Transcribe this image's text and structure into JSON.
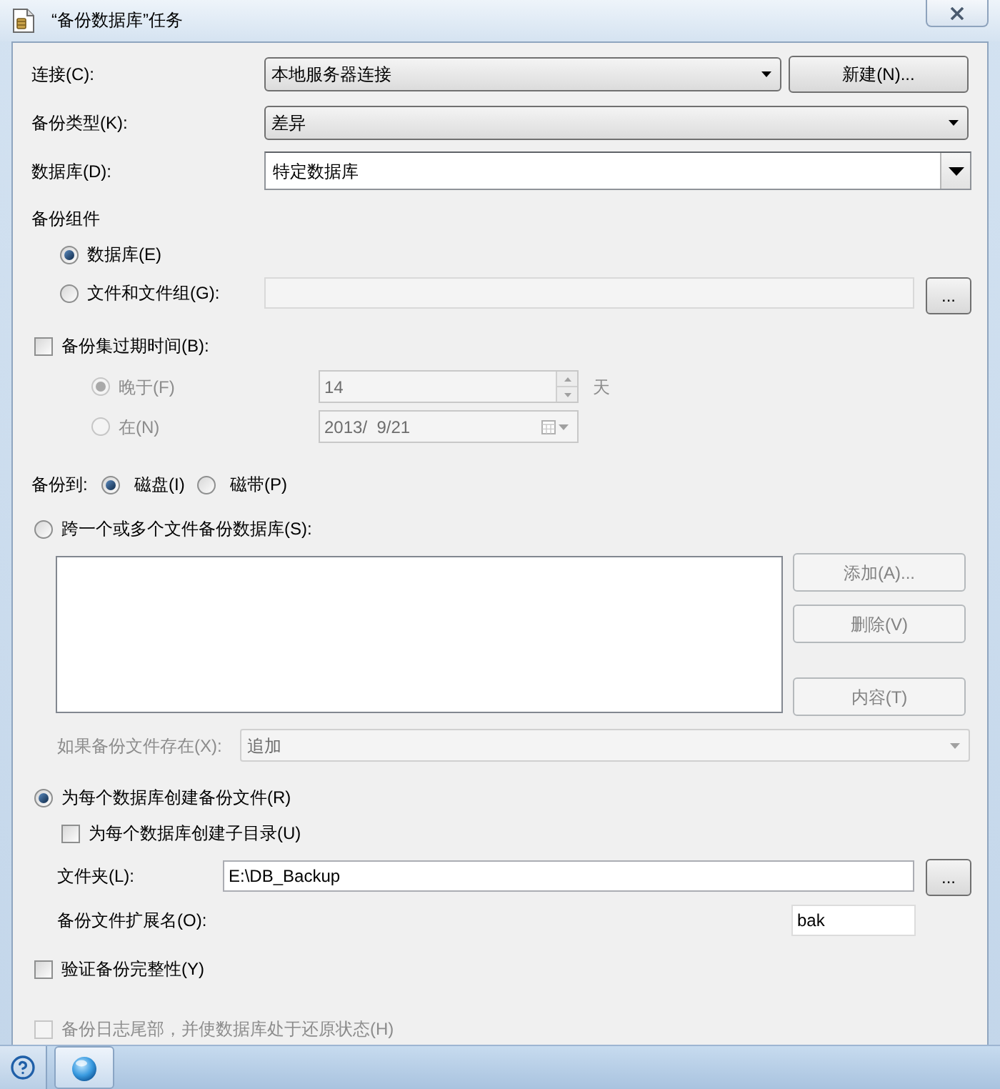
{
  "window": {
    "title": "“备份数据库”任务"
  },
  "connection": {
    "label": "连接(C):",
    "value": "本地服务器连接",
    "new_button": "新建(N)..."
  },
  "backup_type": {
    "label": "备份类型(K):",
    "value": "差异"
  },
  "database": {
    "label": "数据库(D):",
    "value": "特定数据库"
  },
  "backup_component": {
    "heading": "备份组件",
    "options": [
      {
        "label": "数据库(E)",
        "selected": true
      },
      {
        "label": "文件和文件组(G):",
        "selected": false
      }
    ],
    "browse_button": "..."
  },
  "expiration": {
    "label": "备份集过期时间(B):",
    "checked": false,
    "options": [
      {
        "kind": "spin",
        "label": "晚于(F)",
        "selected": true,
        "value": "14",
        "unit": "天"
      },
      {
        "kind": "date",
        "label": "在(N)",
        "selected": false,
        "value": "2013/  9/21"
      }
    ]
  },
  "backup_to": {
    "label": "备份到:",
    "options": [
      {
        "label": "磁盘(I)",
        "selected": true
      },
      {
        "label": "磁带(P)",
        "selected": false
      }
    ]
  },
  "span_files": {
    "label": "跨一个或多个文件备份数据库(S):",
    "selected": false,
    "buttons": [
      "添加(A)...",
      "删除(V)",
      "内容(T)"
    ],
    "if_exists": {
      "label": "如果备份文件存在(X):",
      "value": "追加"
    }
  },
  "per_database": {
    "label": "为每个数据库创建备份文件(R)",
    "selected": true,
    "subdirectory": {
      "label": "为每个数据库创建子目录(U)",
      "checked": false
    },
    "folder": {
      "label": "文件夹(L):",
      "value": "E:\\DB_Backup",
      "browse_button": "..."
    },
    "extension": {
      "label": "备份文件扩展名(O):",
      "value": "bak"
    }
  },
  "verify": {
    "label": "验证备份完整性(Y)",
    "checked": false
  },
  "tail_log": {
    "label": "备份日志尾部，并使数据库处于还原状态(H)",
    "checked": false,
    "disabled": true
  }
}
